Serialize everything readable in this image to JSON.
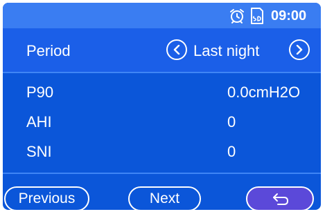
{
  "status_bar": {
    "time": "09:00",
    "icons": [
      "alarm-clock-icon",
      "sd-card-icon"
    ]
  },
  "period": {
    "label": "Period",
    "value": "Last night",
    "prev_icon": "chevron-left-icon",
    "next_icon": "chevron-right-icon"
  },
  "metrics": [
    {
      "label": "P90",
      "value": "0.0cmH2O"
    },
    {
      "label": "AHI",
      "value": "0"
    },
    {
      "label": "SNI",
      "value": "0"
    }
  ],
  "footer": {
    "previous_label": "Previous",
    "next_label": "Next",
    "back_icon": "return-arrow-icon"
  },
  "colors": {
    "screen_background": "#0b56d9",
    "status_bar": "#3a7df2",
    "period_bar": "#1b5fe8",
    "back_button": "#5b49d9",
    "text": "#ffffff"
  }
}
